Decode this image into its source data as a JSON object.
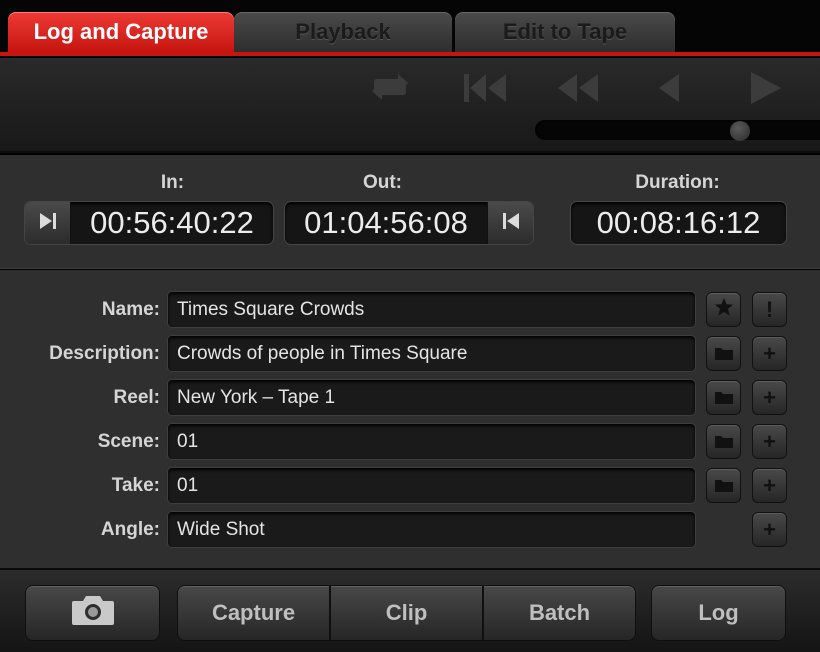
{
  "tabs": [
    {
      "label": "Log and Capture",
      "active": true
    },
    {
      "label": "Playback",
      "active": false
    },
    {
      "label": "Edit to Tape",
      "active": false
    }
  ],
  "transport": {
    "icons": [
      "loop-icon",
      "skip-to-start-icon",
      "rewind-icon",
      "step-back-icon",
      "play-icon"
    ],
    "scrub_position": 0.78
  },
  "timecode": {
    "in_label": "In:",
    "in_value": "00:56:40:22",
    "out_label": "Out:",
    "out_value": "01:04:56:08",
    "duration_label": "Duration:",
    "duration_value": "00:08:16:12"
  },
  "fields": [
    {
      "label": "Name:",
      "value": "Times Square Crowds"
    },
    {
      "label": "Description:",
      "value": "Crowds of people in Times Square"
    },
    {
      "label": "Reel:",
      "value": "New York – Tape 1"
    },
    {
      "label": "Scene:",
      "value": "01"
    },
    {
      "label": "Take:",
      "value": "01"
    },
    {
      "label": "Angle:",
      "value": "Wide Shot"
    }
  ],
  "field_buttons": {
    "favorite_icon": "star-icon",
    "mark_good_symbol": "!",
    "folder_icon": "folder-icon",
    "increment_symbol": "+"
  },
  "bottom": {
    "camera_icon": "camera-icon",
    "capture": "Capture",
    "clip": "Clip",
    "batch": "Batch",
    "log": "Log"
  },
  "colors": {
    "accent_red": "#d41f1a",
    "panel_bg": "#2f2f2f"
  }
}
